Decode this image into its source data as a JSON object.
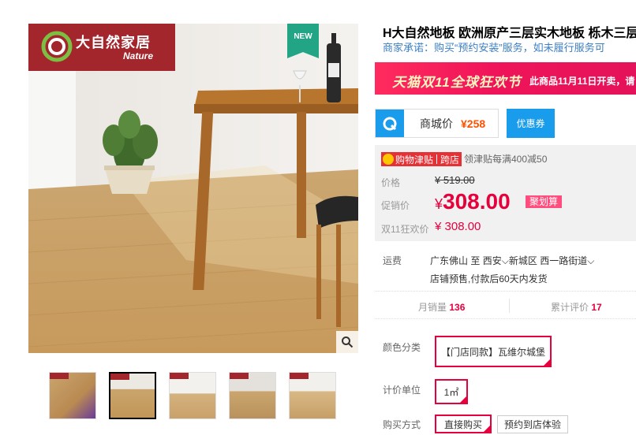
{
  "gallery": {
    "brand_name": "大自然家居",
    "brand_sub": "Nature",
    "new_tag": "NEW"
  },
  "product": {
    "title": "H大自然地板 欧洲原产三层实木地板 栎木三层",
    "promise": "商家承诺：购买“预约安装”服务，如未履行服务可"
  },
  "festival": {
    "title": "天猫双11全球狂欢节",
    "note": "此商品11月11日开卖，请"
  },
  "mall": {
    "label": "商城价",
    "price": "¥258",
    "coupon": "优惠券"
  },
  "price": {
    "jin_tag_left": "购物津贴",
    "jin_tag_right": "跨店",
    "jin_desc": "领津贴每满400减50",
    "orig_label": "价格",
    "orig_yen": "¥",
    "orig_value": "519.00",
    "promo_label": "促销价",
    "promo_yen": "¥",
    "promo_value": "308.00",
    "juhua": "聚划算",
    "fest_label": "双11狂欢价",
    "fest_value": "¥ 308.00"
  },
  "shipping": {
    "label": "运费",
    "route_from": "广东佛山",
    "route_to_word": "至",
    "route_to": "西安",
    "district": "新城区",
    "street": "西一路街道",
    "note": "店铺预售,付款后60天内发货"
  },
  "stats": {
    "monthly_label": "月销量",
    "monthly_value": "136",
    "review_label": "累计评价",
    "review_value": "17"
  },
  "options": {
    "color_label": "颜色分类",
    "color_value": "【门店同款】瓦维尔城堡",
    "unit_label": "计价单位",
    "unit_value": "1㎡",
    "buy_label": "购买方式",
    "buy_direct": "直接购买",
    "buy_store": "预约到店体验"
  },
  "colors": {
    "brand_red": "#a2262c",
    "price_red": "#e6003c",
    "tmall_blue": "#1a9cec",
    "festival_pink": "#f0145a"
  }
}
